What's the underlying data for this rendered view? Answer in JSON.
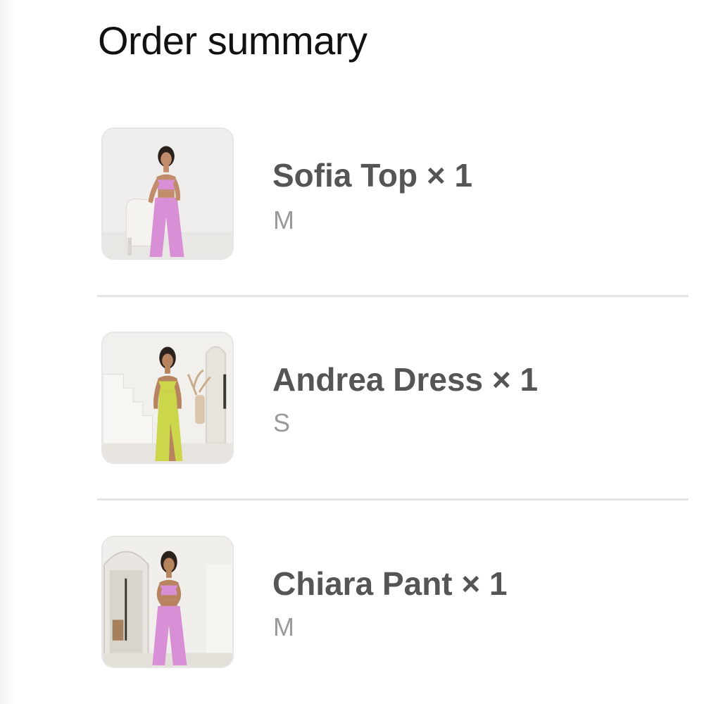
{
  "header": {
    "title": "Order summary"
  },
  "items": [
    {
      "name": "Sofia Top × 1",
      "variant": "M",
      "image": "product-photo-sofia-top",
      "accent": "#d98fd6"
    },
    {
      "name": "Andrea Dress × 1",
      "variant": "S",
      "image": "product-photo-andrea-dress",
      "accent": "#cbd64a"
    },
    {
      "name": "Chiara Pant × 1",
      "variant": "M",
      "image": "product-photo-chiara-pant",
      "accent": "#d98fd6"
    }
  ]
}
